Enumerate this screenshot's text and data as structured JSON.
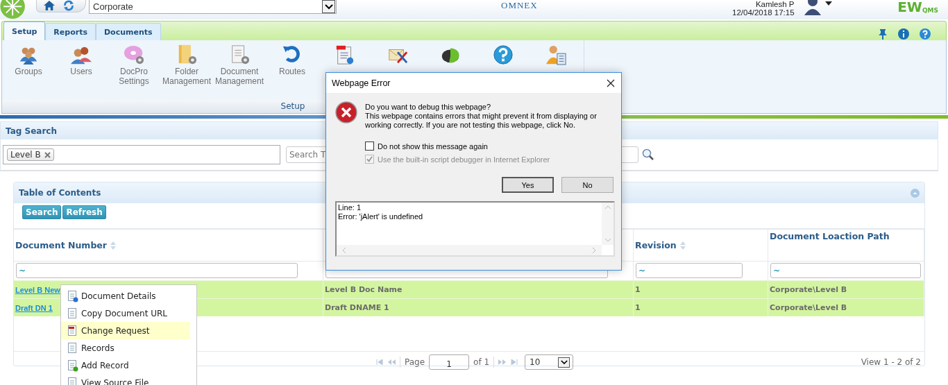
{
  "top_bar": {
    "site_select": {
      "value": "Corporate"
    },
    "vendor_logo": "OMNEX",
    "user": {
      "name": "Kamlesh P",
      "datetime": "12/04/2018 17:15"
    },
    "product_logo": {
      "main": "EW",
      "sub": "QMS"
    }
  },
  "tabs": [
    {
      "label": "Setup",
      "selected": true
    },
    {
      "label": "Reports",
      "selected": false
    },
    {
      "label": "Documents",
      "selected": false
    }
  ],
  "ribbon": {
    "items": [
      {
        "kind": "labeled",
        "label": "Groups"
      },
      {
        "kind": "labeled",
        "label": "Users"
      },
      {
        "kind": "labeled",
        "label": "DocPro Settings"
      },
      {
        "kind": "labeled",
        "label": "Folder Management"
      },
      {
        "kind": "labeled",
        "label": "Document Management"
      },
      {
        "kind": "labeled",
        "label": "Routes"
      },
      {
        "kind": "icon"
      },
      {
        "kind": "icon"
      },
      {
        "kind": "icon"
      },
      {
        "kind": "icon"
      },
      {
        "kind": "icon"
      }
    ],
    "group_label": "Setup"
  },
  "tag_search": {
    "title": "Tag Search",
    "tags": [
      "Level B"
    ],
    "search": {
      "placeholder": "Search T"
    }
  },
  "toc": {
    "title": "Table of Contents",
    "buttons": [
      "Search",
      "Refresh"
    ],
    "columns": [
      {
        "label": "Document Number",
        "sortable": true,
        "filter": "~"
      },
      {
        "filter_field": true
      },
      {
        "label": "Revision",
        "sortable": true,
        "filter": "~"
      },
      {
        "label": "Document Loaction Path",
        "sortable": false,
        "filter": "~"
      }
    ],
    "rows": [
      [
        "Level B New",
        "Level B Doc Name",
        "1",
        "Corporate\\Level B"
      ],
      [
        "Draft DN 1",
        "Draft DNAME 1",
        "1",
        "Corporate\\Level B"
      ]
    ],
    "pager": {
      "page_label": "Page",
      "page": "1",
      "of": "of 1",
      "page_size": "10",
      "summary": "View 1 - 2 of 2"
    }
  },
  "context_menu": [
    {
      "label": "Document Details",
      "selected": false
    },
    {
      "label": "Copy Document URL",
      "selected": false
    },
    {
      "label": "Change Request",
      "selected": true
    },
    {
      "label": "Records",
      "selected": false
    },
    {
      "label": "Add Record",
      "selected": false
    },
    {
      "label": "View Source File",
      "selected": false
    }
  ],
  "dialog": {
    "title": "Webpage Error",
    "heading": "Do you want to debug this webpage?",
    "body": "This webpage contains errors that might prevent it from displaying or working correctly. If you are not testing this webpage, click No.",
    "checkboxes": [
      {
        "label": "Do not show this message again",
        "checked": false,
        "disabled": false
      },
      {
        "label": "Use the built-in script debugger in Internet Explorer",
        "checked": true,
        "disabled": true
      }
    ],
    "buttons": [
      {
        "label": "Yes",
        "default": true
      },
      {
        "label": "No",
        "default": false
      }
    ],
    "details": [
      "Line: 1",
      "Error: 'jAlert' is undefined"
    ]
  }
}
